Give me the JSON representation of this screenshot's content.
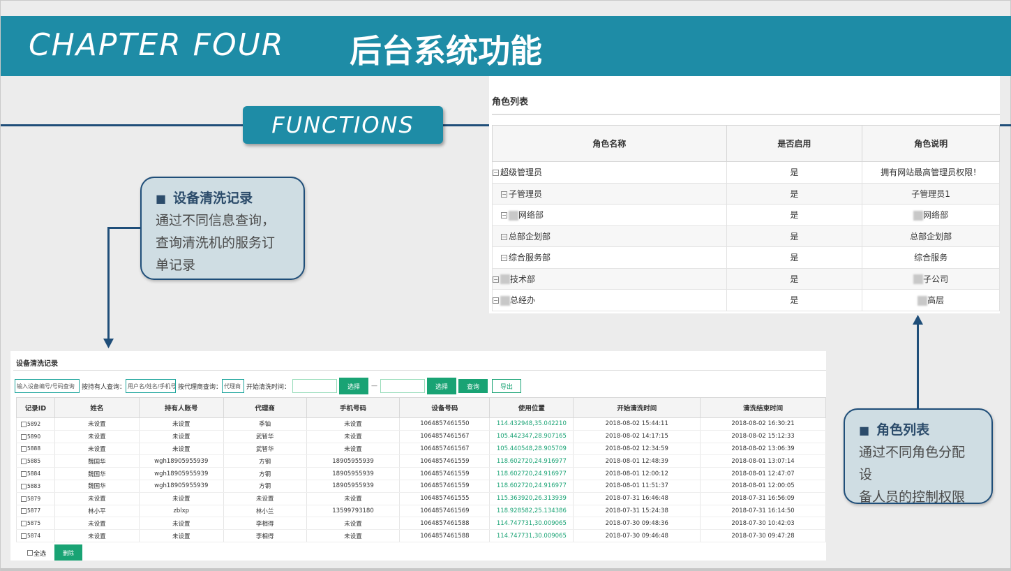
{
  "header": {
    "chapter": "CHAPTER FOUR",
    "title_cn": "后台系统功能"
  },
  "functions_label": "FUNCTIONS",
  "callout_left": {
    "marker": "■",
    "title": "设备清洗记录",
    "body": [
      "通过不同信息查询，",
      "查询清洗机的服务订",
      "单记录"
    ]
  },
  "callout_right": {
    "marker": "■",
    "title": "角色列表",
    "body": [
      "通过不同角色分配设",
      "备人员的控制权限"
    ]
  },
  "role_panel": {
    "title": "角色列表",
    "headers": [
      "角色名称",
      "是否启用",
      "角色说明"
    ],
    "rows": [
      {
        "name": "超级管理员",
        "enabled": "是",
        "desc": "拥有网站最高管理员权限！"
      },
      {
        "name": "子管理员",
        "enabled": "是",
        "desc": "子管理员1"
      },
      {
        "name": "网络部",
        "enabled": "是",
        "desc": "网络部"
      },
      {
        "name": "总部企划部",
        "enabled": "是",
        "desc": "总部企划部"
      },
      {
        "name": "综合服务部",
        "enabled": "是",
        "desc": "综合服务"
      },
      {
        "name": "技术部",
        "enabled": "是",
        "desc": "子公司"
      },
      {
        "name": "总经办",
        "enabled": "是",
        "desc": "高层"
      }
    ]
  },
  "record_panel": {
    "title": "设备清洗记录",
    "filters": {
      "device_placeholder": "输入设备编号/号码查询",
      "holder_label": "按持有人查询：",
      "holder_placeholder": "用户名/姓名/手机号",
      "agent_label": "按代理商查询：",
      "agent_placeholder": "代理商",
      "start_label": "开始清洗时间：",
      "select_label": "选择",
      "dash": "—",
      "select_label2": "选择",
      "query_label": "查询",
      "export_label": "导出"
    },
    "headers": [
      "记录ID",
      "姓名",
      "持有人账号",
      "代理商",
      "手机号码",
      "设备号码",
      "使用位置",
      "开始清洗时间",
      "清洗结束时间"
    ],
    "rows": [
      [
        "5892",
        "未设置",
        "未设置",
        "季铀",
        "未设置",
        "1064857461550",
        "114.432948,35.042210",
        "2018-08-02 15:44:11",
        "2018-08-02 16:30:21"
      ],
      [
        "5890",
        "未设置",
        "未设置",
        "武智华",
        "未设置",
        "1064857461567",
        "105.442347,28.907165",
        "2018-08-02 14:17:15",
        "2018-08-02 15:12:33"
      ],
      [
        "5888",
        "未设置",
        "未设置",
        "武智华",
        "未设置",
        "1064857461567",
        "105.440548,28.905709",
        "2018-08-02 12:34:59",
        "2018-08-02 13:06:39"
      ],
      [
        "5885",
        "魏国华",
        "wgh18905955939",
        "方钢",
        "18905955939",
        "1064857461559",
        "118.602720,24.916977",
        "2018-08-01 12:48:39",
        "2018-08-01 13:07:14"
      ],
      [
        "5884",
        "魏国华",
        "wgh18905955939",
        "方钢",
        "18905955939",
        "1064857461559",
        "118.602720,24.916977",
        "2018-08-01 12:00:12",
        "2018-08-01 12:47:07"
      ],
      [
        "5883",
        "魏国华",
        "wgh18905955939",
        "方钢",
        "18905955939",
        "1064857461559",
        "118.602720,24.916977",
        "2018-08-01 11:51:37",
        "2018-08-01 12:00:05"
      ],
      [
        "5879",
        "未设置",
        "未设置",
        "未设置",
        "未设置",
        "1064857461555",
        "115.363920,26.313939",
        "2018-07-31 16:46:48",
        "2018-07-31 16:56:09"
      ],
      [
        "5877",
        "林小平",
        "zblxp",
        "林小兰",
        "13599793180",
        "1064857461569",
        "118.928582,25.134386",
        "2018-07-31 15:24:38",
        "2018-07-31 16:14:50"
      ],
      [
        "5875",
        "未设置",
        "未设置",
        "李相得",
        "未设置",
        "1064857461588",
        "114.747731,30.009065",
        "2018-07-30 09:48:36",
        "2018-07-30 10:42:03"
      ],
      [
        "5874",
        "未设置",
        "未设置",
        "李相得",
        "未设置",
        "1064857461588",
        "114.747731,30.009065",
        "2018-07-30 09:46:48",
        "2018-07-30 09:47:28"
      ]
    ],
    "footer": {
      "select_all": "全选",
      "delete_label": "删除"
    }
  },
  "colors": {
    "header_band": "#1e8ca6",
    "rule": "#1f4e79",
    "callout_bg": "#cfdde3",
    "button_green": "#19a374"
  }
}
